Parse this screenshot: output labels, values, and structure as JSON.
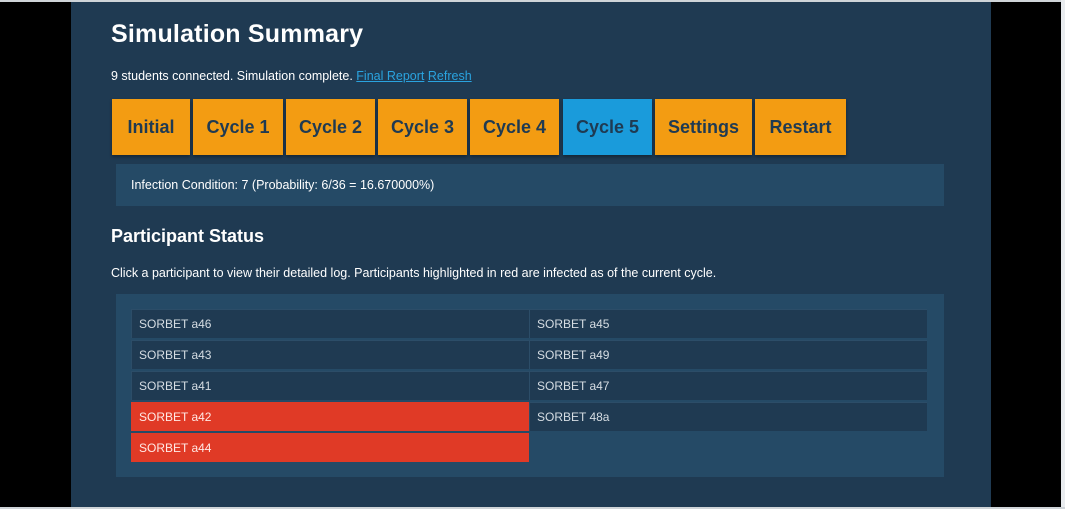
{
  "header": {
    "title": "Simulation Summary",
    "status_text": "9 students connected. Simulation complete.",
    "final_report_link": "Final Report",
    "refresh_link": "Refresh"
  },
  "tabs": [
    {
      "label": "Initial",
      "active": false
    },
    {
      "label": "Cycle 1",
      "active": false
    },
    {
      "label": "Cycle 2",
      "active": false
    },
    {
      "label": "Cycle 3",
      "active": false
    },
    {
      "label": "Cycle 4",
      "active": false
    },
    {
      "label": "Cycle 5",
      "active": true
    },
    {
      "label": "Settings",
      "active": false
    },
    {
      "label": "Restart",
      "active": false
    }
  ],
  "infection_condition": "Infection Condition: 7 (Probability: 6/36 = 16.670000%)",
  "participants_section": {
    "title": "Participant Status",
    "hint": "Click a participant to view their detailed log. Participants highlighted in red are infected as of the current cycle.",
    "participants": [
      {
        "name": "SORBET a46",
        "infected": false
      },
      {
        "name": "SORBET a45",
        "infected": false
      },
      {
        "name": "SORBET a43",
        "infected": false
      },
      {
        "name": "SORBET a49",
        "infected": false
      },
      {
        "name": "SORBET a41",
        "infected": false
      },
      {
        "name": "SORBET a47",
        "infected": false
      },
      {
        "name": "SORBET a42",
        "infected": true
      },
      {
        "name": "SORBET 48a",
        "infected": false
      },
      {
        "name": "SORBET a44",
        "infected": true
      }
    ]
  },
  "colors": {
    "panel_bg": "#1f3a52",
    "tab_bg": "#f39c12",
    "tab_active_bg": "#1a9bdb",
    "infected_bg": "#e03a26",
    "link": "#2aa3df"
  }
}
